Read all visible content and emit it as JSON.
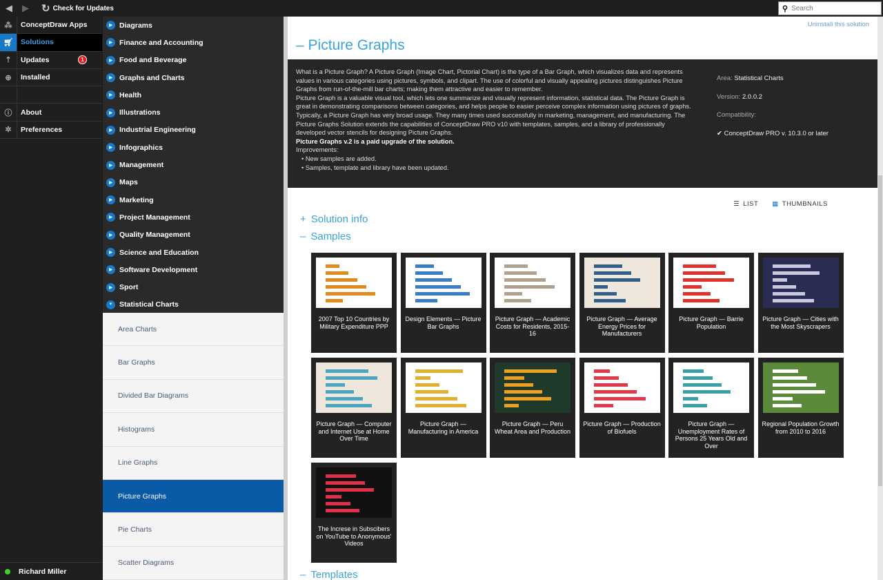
{
  "topbar": {
    "check_updates": "Check for Updates",
    "search_placeholder": "Search"
  },
  "leftnav": {
    "items": [
      {
        "label": "ConceptDraw Apps",
        "icon": "apps-icon"
      },
      {
        "label": "Solutions",
        "icon": "cart-icon",
        "selected": true
      },
      {
        "label": "Updates",
        "icon": "updates-icon",
        "badge": "1"
      },
      {
        "label": "Installed",
        "icon": "download-icon"
      },
      {
        "label": "",
        "icon": ""
      },
      {
        "label": "About",
        "icon": "info-icon"
      },
      {
        "label": "Preferences",
        "icon": "gear-icon"
      }
    ],
    "user": "Richard Miller"
  },
  "categories": [
    "Diagrams",
    "Finance and Accounting",
    "Food and Beverage",
    "Graphs and Charts",
    "Health",
    "Illustrations",
    "Industrial Engineering",
    "Infographics",
    "Management",
    "Maps",
    "Marketing",
    "Project Management",
    "Quality Management",
    "Science and Education",
    "Software Development",
    "Sport",
    "Statistical Charts"
  ],
  "subcategories": [
    "Area Charts",
    "Bar Graphs",
    "Divided Bar Diagrams",
    "Histograms",
    "Line Graphs",
    "Picture Graphs",
    "Pie Charts",
    "Scatter Diagrams"
  ],
  "main": {
    "uninstall": "Uninstall this solution",
    "title": "Picture Graphs",
    "description": {
      "p1": "What is a Picture Graph? A Picture Graph (Image Chart, Pictorial Chart) is the type of a Bar Graph, which visualizes data and represents values in various categories using pictures, symbols, and clipart. The use of colorful and visually appealing pictures distinguishes Picture Graphs from run-of-the-mill bar charts; making them attractive and easier to remember.",
      "p2": "Picture Graph is a valuable visual tool, which lets one summarize and visually represent information, statistical data. The Picture Graph is great in demonstrating comparisons between categories, and helps people to easier perceive complex information using pictures of graphs.",
      "p3": "Typically, a Picture Graph has very broad usage. They many times used successfully in marketing, management, and manufacturing. The Picture Graphs Solution extends the capabilities of ConceptDraw PRO v10 with templates, samples, and a library of professionally developed vector stencils for designing Picture Graphs.",
      "p4": "Picture Graphs v.2 is a paid upgrade of the solution.",
      "p5": "Improvements:",
      "b1": "• New samples are added.",
      "b2": "• Samples, template and library have been updated."
    },
    "meta": {
      "area_label": "Area:",
      "area": "Statistical Charts",
      "version_label": "Version:",
      "version": "2.0.0.2",
      "compat_label": "Compatibility:",
      "compat": "ConceptDraw PRO v. 10.3.0 or later"
    },
    "view": {
      "list": "LIST",
      "thumbnails": "THUMBNAILS"
    },
    "sections": {
      "info": "Solution info",
      "samples": "Samples",
      "templates": "Templates",
      "info_sign": "+",
      "samples_sign": "–",
      "templates_sign": "–"
    },
    "samples": [
      {
        "label": "2007 Top 10 Countries by Military Expenditure PPP",
        "bg": "#ffffff",
        "fg": "#e08a1e"
      },
      {
        "label": "Design Elements — Picture Bar Graphs",
        "bg": "#ffffff",
        "fg": "#3a7ec8"
      },
      {
        "label": "Picture Graph — Academic Costs for Residents, 2015-16",
        "bg": "#ffffff",
        "fg": "#b0a090"
      },
      {
        "label": "Picture Graph — Average Energy Prices for Manufacturers",
        "bg": "#efe7dc",
        "fg": "#2f5f8a"
      },
      {
        "label": "Picture Graph — Barrie Population",
        "bg": "#ffffff",
        "fg": "#e0322a"
      },
      {
        "label": "Picture Graph — Cities with the Most Skyscrapers",
        "bg": "#2a2c54",
        "fg": "#c9c9e0"
      },
      {
        "label": "Picture Graph — Computer and Internet Use at Home Over Time",
        "bg": "#efe7dc",
        "fg": "#4aa6c0"
      },
      {
        "label": "Picture Graph — Manufacturing in America",
        "bg": "#ffffff",
        "fg": "#e0b030"
      },
      {
        "label": "Picture Graph — Peru Wheat Area and Production",
        "bg": "#1f3a2a",
        "fg": "#f0a020"
      },
      {
        "label": "Picture Graph — Production of Biofuels",
        "bg": "#ffffff",
        "fg": "#e03a4a"
      },
      {
        "label": "Picture Graph — Unemployment Rates of Persons 25 Years Old and Over",
        "bg": "#ffffff",
        "fg": "#3aa0a8"
      },
      {
        "label": "Regional Population Growth from 2010 to 2016",
        "bg": "#5a8a3a",
        "fg": "#ffffff"
      },
      {
        "label": "The Increse in Subscibers on YouTube to Anonymous' Videos",
        "bg": "#111111",
        "fg": "#e0304a"
      }
    ]
  }
}
